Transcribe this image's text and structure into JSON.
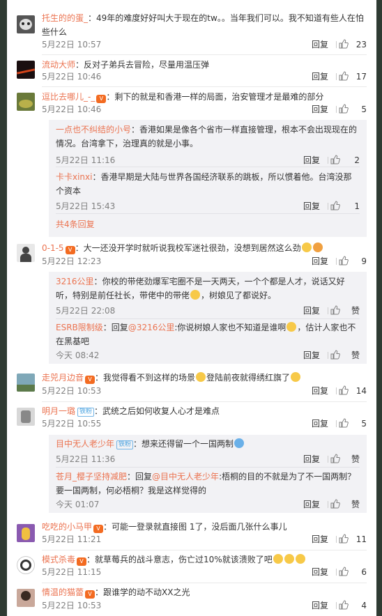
{
  "labels": {
    "reply": "回复",
    "sep": "："
  },
  "comments": [
    {
      "user": "托生的的蛋_",
      "text": "49年的难度好好叫大于现在的tw。。当年我们可以。我不知道有些人在怕些什么",
      "time": "5月22日 10:57",
      "likes": "23"
    },
    {
      "user": "流动大师",
      "text": "反对子弟兵去冒险，尽量用温压弹",
      "time": "5月22日 10:46",
      "likes": "17"
    },
    {
      "user": "逗比去哪儿_-_",
      "text": "剩下的就是和香港一样的局面，治安管理才是最难的部分",
      "time": "5月22日 10:46",
      "likes": "5",
      "replies": [
        {
          "user": "一点也不纠结的小号",
          "text": "香港如果是像各个省市一样直接管理，根本不会出现现在的情况。台湾拿下，治理真的就是小事。",
          "time": "5月22日 11:16",
          "likes": "2"
        },
        {
          "user": "卡卡xinxi",
          "text": "香港早期是大陆与世界各国经济联系的跳板，所以惯着他。台湾没那个资本",
          "time": "5月22日 15:43",
          "likes": "1"
        }
      ],
      "more": "共4条回复"
    },
    {
      "user": "0-1-5",
      "text": "大一还没开学时就听说我校军迷社很劲，没想到居然这么劲",
      "time": "5月22日 12:23",
      "likes": "9",
      "replies": [
        {
          "user": "3216公里",
          "text": "你校的带佬劲爆军宅圈不是一天两天，一个个都是人才，说话又好听，特别是前任社长，带佬中的带佬",
          "text2": "，树娘见了都说好。",
          "time": "5月22日 22:08",
          "likes": "赞"
        },
        {
          "user": "ESRB限制级",
          "text": "回复",
          "mention": "@3216公里",
          "text2": ":你说树娘人家也不知道是谁啊",
          "text3": "，估计人家也不在黑基吧",
          "time": "今天 08:42",
          "likes": "赞"
        }
      ]
    },
    {
      "user": "走兕月边音",
      "text": "我觉得看不到这样的场景",
      "text2": "登陆前夜就得绣红旗了",
      "time": "5月22日 10:53",
      "likes": "14"
    },
    {
      "user": "明月一璐",
      "badge": "铁粉",
      "text": "武统之后如何收复人心才是难点",
      "time": "5月22日 10:55",
      "likes": "5",
      "replies": [
        {
          "user": "目中无人老少年",
          "badge": "铁粉",
          "text": "想来还得留一个一国两制",
          "time": "5月22日 11:36",
          "likes": "赞"
        },
        {
          "user": "苍月_樱子坚持减肥",
          "text": "回复",
          "mention": "@目中无人老少年",
          "text2": ":梧桐的目的不就是为了不一国两制？要一国两制，何必梧桐？我是这样觉得的",
          "time": "今天 01:07",
          "likes": "赞"
        }
      ]
    },
    {
      "user": "吃吃的小马甲",
      "text": "可能一登录就直接图 1了，没后面几张什么事儿",
      "time": "5月22日 11:21",
      "likes": "11"
    },
    {
      "user": "模式杀毒",
      "text": "就草莓兵的战斗意志，伤亡过10%就该溃败了吧",
      "time": "5月22日 11:15",
      "likes": "6"
    },
    {
      "user": "情温的猫蕾",
      "text": "跟谁学的动不动XX之光",
      "time": "5月22日 10:53",
      "likes": "4"
    }
  ]
}
